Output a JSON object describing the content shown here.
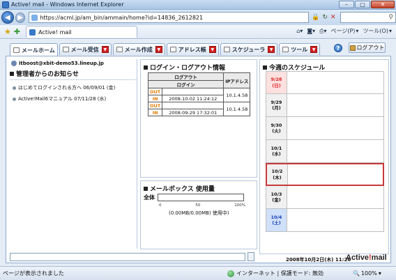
{
  "window": {
    "title": "Active! mail - Windows Internet Explorer"
  },
  "browser": {
    "url": "https://acml.jp/am_bin/ammain/home?id=14836_2612821",
    "tab_title": "Active! mail",
    "page_menu": "ページ(P)",
    "tools_menu": "ツール(O)"
  },
  "tabs": [
    {
      "label": "メールホーム"
    },
    {
      "label": "メール受信"
    },
    {
      "label": "メール作成"
    },
    {
      "label": "アドレス帳"
    },
    {
      "label": "スケジューラ"
    },
    {
      "label": "ツール"
    }
  ],
  "header": {
    "logout_label": "ログアウト"
  },
  "account": {
    "email": "itboost@xbit-demo53.lineup.jp"
  },
  "notices": {
    "title": "管理者からのお知らせ",
    "items": [
      {
        "text": "はじめてログインされる方へ 06/09/01 (金)"
      },
      {
        "text": "Active!Mail6マニュアル 07/11/28 (水)"
      }
    ]
  },
  "login_info": {
    "title": "ログイン・ログアウト情報",
    "col_logout": "ログアウト",
    "col_login": "ログイン",
    "col_ip": "IPアドレス",
    "rows": [
      {
        "out_label": "OUT",
        "out_time": "",
        "in_label": "IN",
        "in_time": "2008-10-02 11:24:12",
        "ip": "10.1.4.58"
      },
      {
        "out_label": "OUT",
        "out_time": "",
        "in_label": "IN",
        "in_time": "2008-09-29 17:32:01",
        "ip": "10.1.4.58"
      }
    ]
  },
  "mailbox": {
    "title": "メールボックス 使用量",
    "label": "全体",
    "usage_fraction": 0.0,
    "scale": [
      "0",
      "50",
      "100%"
    ],
    "usage_text": "(0.00MB/0.00MB) 使用中)"
  },
  "schedule": {
    "title": "今週のスケジュール",
    "days": [
      {
        "date": "9/28",
        "dow": "(日)",
        "kind": "sun",
        "today": false
      },
      {
        "date": "9/29",
        "dow": "(月)",
        "kind": "weekday",
        "today": false
      },
      {
        "date": "9/30",
        "dow": "(火)",
        "kind": "weekday",
        "today": false
      },
      {
        "date": "10/1",
        "dow": "(水)",
        "kind": "weekday",
        "today": false
      },
      {
        "date": "10/2",
        "dow": "(木)",
        "kind": "weekday",
        "today": true
      },
      {
        "date": "10/3",
        "dow": "(金)",
        "kind": "weekday",
        "today": false
      },
      {
        "date": "10/4",
        "dow": "(土)",
        "kind": "sat",
        "today": false
      }
    ]
  },
  "footer": {
    "datetime": "2008年10月2日(木) 11:26",
    "brand_main": "Active",
    "brand_mark": "!",
    "brand_tail": "mail"
  },
  "status": {
    "message": "ページが表示されました",
    "zone": "インターネット | 保護モード: 無効",
    "zoom": "100%"
  }
}
